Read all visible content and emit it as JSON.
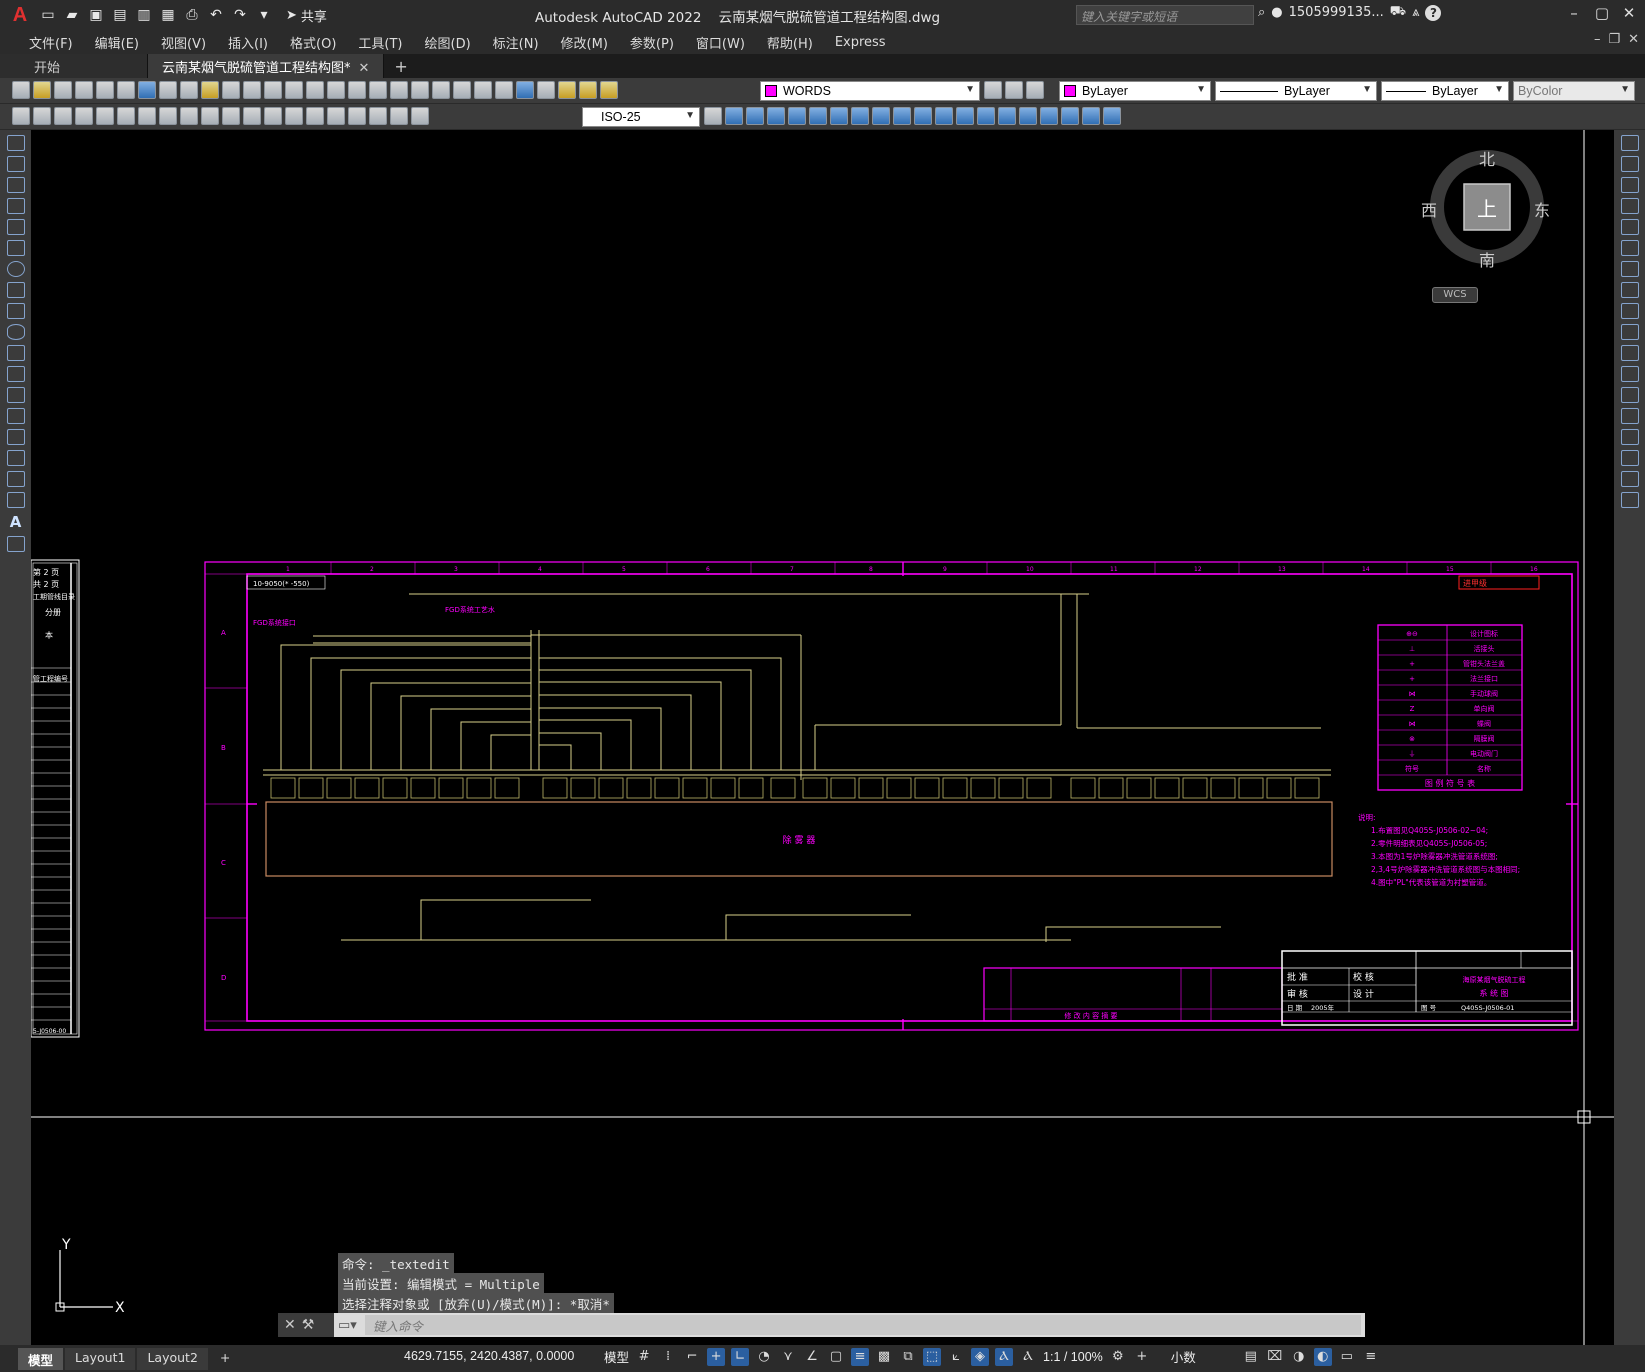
{
  "app": {
    "logo": "A",
    "title": "Autodesk AutoCAD 2022",
    "document": "云南某烟气脱硫管道工程结构图.dwg",
    "share_label": "共享",
    "search_placeholder": "键入关键字或短语",
    "user": "1505999135...",
    "help": "?"
  },
  "menu": [
    "文件(F)",
    "编辑(E)",
    "视图(V)",
    "插入(I)",
    "格式(O)",
    "工具(T)",
    "绘图(D)",
    "标注(N)",
    "修改(M)",
    "参数(P)",
    "窗口(W)",
    "帮助(H)",
    "Express"
  ],
  "tabs": [
    {
      "label": "开始",
      "active": false
    },
    {
      "label": "云南某烟气脱硫管道工程结构图*",
      "active": true
    }
  ],
  "toolbar": {
    "layer": "WORDS",
    "color": "ByLayer",
    "linetype": "ByLayer",
    "lineweight": "ByLayer",
    "plotstyle": "ByColor",
    "dimstyle": "ISO-25",
    "layer_color": "#ff00ff"
  },
  "viewcube": {
    "north": "北",
    "south": "南",
    "east": "东",
    "west": "西",
    "top": "上",
    "wcs": "WCS"
  },
  "ucs": {
    "x": "X",
    "y": "Y"
  },
  "drawing": {
    "left_sheet_lines": [
      "第 2 页",
      "共 2 页",
      "工期管线目录",
      "分册",
      "本",
      "管工程编号"
    ],
    "left_sheet_id": "5-J0506-00",
    "stamp": "进甲级",
    "top_left_label": "10-9050(* -550)",
    "main_tank_label": "除 雾 器",
    "legend": {
      "rows": [
        [
          "⊕⊖",
          "设计图标"
        ],
        [
          "⊥",
          "活接头"
        ],
        [
          "+",
          "管钳头法兰盖"
        ],
        [
          "+",
          "法兰接口"
        ],
        [
          "⋈",
          "手动球阀"
        ],
        [
          "Z",
          "单向阀"
        ],
        [
          "⋈",
          "蝶阀"
        ],
        [
          "⊗",
          "隔膜阀"
        ],
        [
          "⏚",
          "电动阀门"
        ],
        [
          "符号",
          "名称"
        ]
      ],
      "title": "图 例 符 号 表"
    },
    "notes": {
      "heading": "说明:",
      "lines": [
        "1.布置图见Q405S-J0506-02~04;",
        "2.零件明细表见Q405S-J0506-05;",
        "3.本图为1号炉除雾器冲洗管道系统图;",
        "  2,3,4号炉除雾器冲洗管道系统图与本图相同;",
        "4.图中\"PL\"代表该管道为衬塑管道。"
      ]
    },
    "title_block": {
      "approve": "批 准",
      "check": "校 核",
      "review": "审 核",
      "design": "设 计",
      "project": "海原某烟气脱硫工程",
      "drawing_name": "系 统 图",
      "sheet_label": "图 号",
      "sheet_no": "Q405S-J0506-01",
      "date_label": "日 期",
      "date_value": "2005年",
      "rev_header": "修 改 内 容 摘 要"
    },
    "row_labels": [
      "A",
      "B",
      "C",
      "D"
    ],
    "col_labels": [
      "1",
      "2",
      "3",
      "4",
      "5",
      "6",
      "7",
      "8",
      "9",
      "10",
      "11",
      "12",
      "13",
      "14",
      "15",
      "16"
    ],
    "callout_1": "FGD系统接口",
    "callout_2": "FGD系统工艺水"
  },
  "command_history": [
    "命令: _textedit",
    "当前设置: 编辑模式 = Multiple",
    "选择注释对象或 [放弃(U)/模式(M)]: *取消*"
  ],
  "command_placeholder": "键入命令",
  "status": {
    "layout_tabs": [
      {
        "label": "模型",
        "active": true
      },
      {
        "label": "Layout1",
        "active": false
      },
      {
        "label": "Layout2",
        "active": false
      }
    ],
    "coords": "4629.7155, 2420.4387, 0.0000",
    "mode": "模型",
    "scale": "1:1 / 100%",
    "units": "小数"
  }
}
